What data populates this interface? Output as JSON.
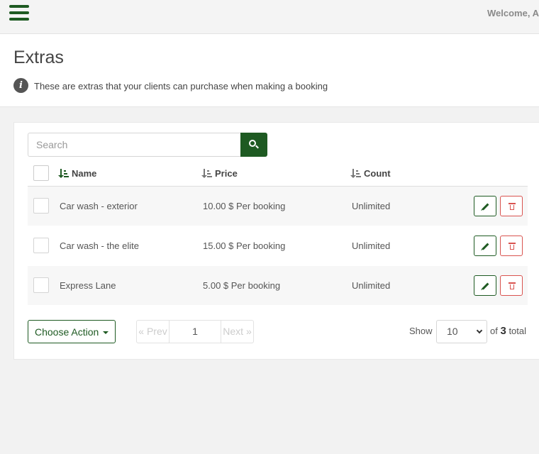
{
  "topbar": {
    "welcome": "Welcome, Ad"
  },
  "header": {
    "title": "Extras",
    "info": "These are extras that your clients can purchase when making a booking"
  },
  "search": {
    "placeholder": "Search"
  },
  "table": {
    "columns": {
      "name": "Name",
      "price": "Price",
      "count": "Count"
    },
    "rows": [
      {
        "name": "Car wash - exterior",
        "price": "10.00 $ Per booking",
        "count": "Unlimited"
      },
      {
        "name": "Car wash - the elite",
        "price": "15.00 $ Per booking",
        "count": "Unlimited"
      },
      {
        "name": "Express Lane",
        "price": "5.00 $ Per booking",
        "count": "Unlimited"
      }
    ]
  },
  "footer": {
    "choose_action": "Choose Action",
    "prev": "« Prev",
    "page": "1",
    "next": "Next »",
    "show": "Show",
    "page_size": "10",
    "total_prefix": "of",
    "total_count": "3",
    "total_suffix": "total"
  },
  "colors": {
    "accent": "#1e5a22",
    "danger": "#d9534f"
  }
}
